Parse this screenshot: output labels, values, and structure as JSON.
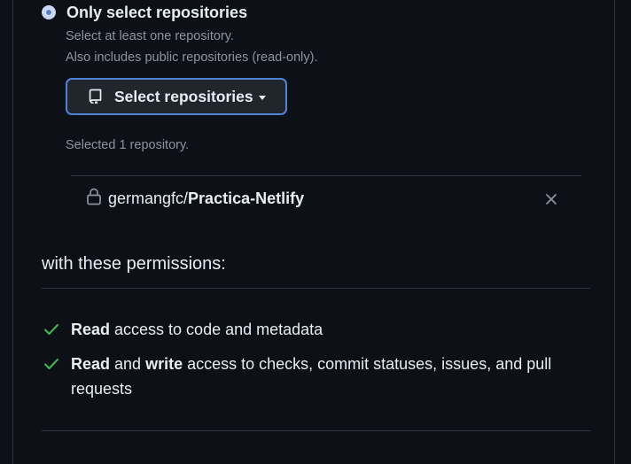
{
  "access": {
    "option_label": "Only select repositories",
    "hint_line1": "Select at least one repository.",
    "hint_line2": "Also includes public repositories (read-only).",
    "select_button_label": "Select repositories",
    "selected_count_text": "Selected 1 repository."
  },
  "selected_repos": [
    {
      "owner": "germangfc/",
      "name": "Practica-Netlify",
      "icon": "lock-icon"
    }
  ],
  "permissions": {
    "heading": "with these permissions:",
    "items": [
      {
        "icon": "check-icon",
        "parts": [
          {
            "text": "Read",
            "bold": true
          },
          {
            "text": " access to code and metadata",
            "bold": false
          }
        ]
      },
      {
        "icon": "check-icon",
        "parts": [
          {
            "text": "Read",
            "bold": true
          },
          {
            "text": " and ",
            "bold": false
          },
          {
            "text": "write",
            "bold": true
          },
          {
            "text": " access to checks, commit statuses, issues, and pull requests",
            "bold": false
          }
        ]
      }
    ]
  },
  "colors": {
    "background": "#0d1117",
    "border": "#30363d",
    "accent": "#4f83d8",
    "success": "#3fb950",
    "muted": "#8b949e"
  }
}
